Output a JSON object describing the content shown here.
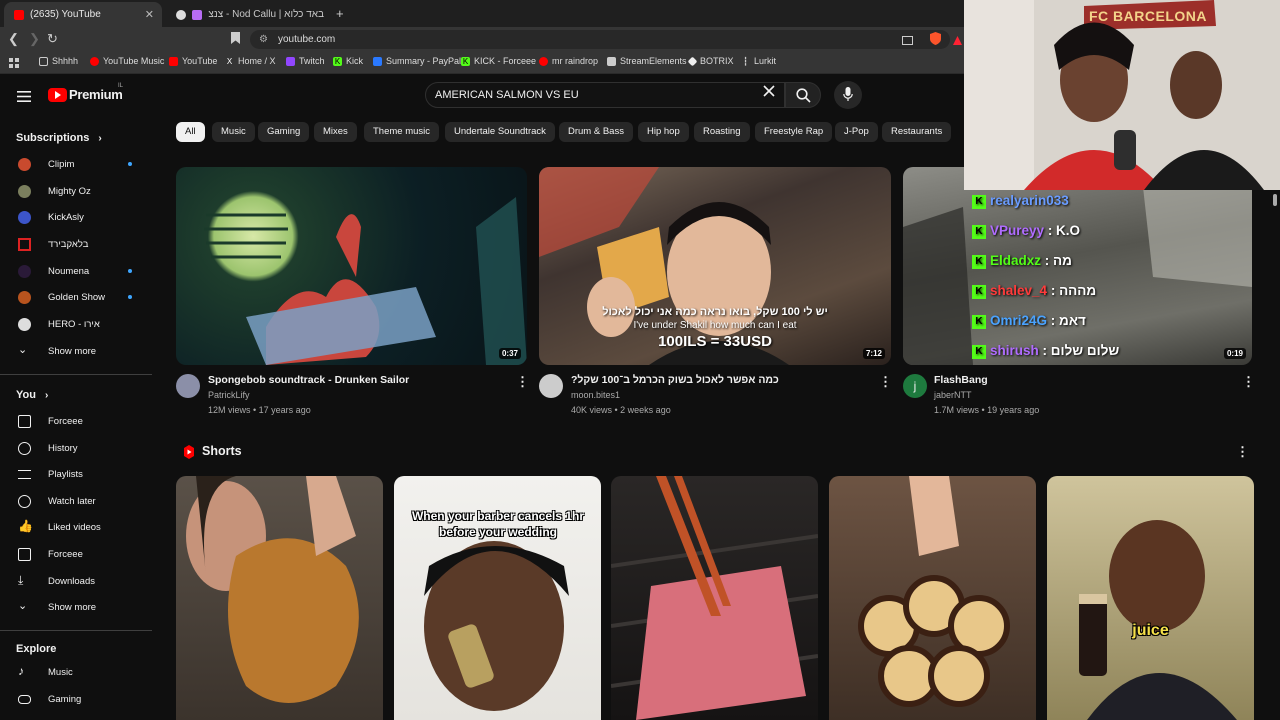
{
  "browser": {
    "tabs": [
      {
        "title": "(2635) YouTube",
        "active": true,
        "close": "✕"
      },
      {
        "title": "באד כלוא | Nod Callu - צנצנות גוּ",
        "active": false,
        "close": ""
      }
    ],
    "new_tab": "+",
    "url": "youtube.com",
    "bookmarks": [
      {
        "label": "Shhhh",
        "icon": "folder-icon"
      },
      {
        "label": "YouTube Music",
        "icon": "youtube-music-icon"
      },
      {
        "label": "YouTube",
        "icon": "youtube-icon"
      },
      {
        "label": "Home / X",
        "icon": "x-icon"
      },
      {
        "label": "Twitch",
        "icon": "twitch-icon"
      },
      {
        "label": "Kick",
        "icon": "kick-icon"
      },
      {
        "label": "Summary - PayPal",
        "icon": "paypal-icon"
      },
      {
        "label": "KICK - Forceee",
        "icon": "kick-icon"
      },
      {
        "label": "mr raindrop",
        "icon": "youtube-icon"
      },
      {
        "label": "StreamElements",
        "icon": "streamelements-icon"
      },
      {
        "label": "BOTRIX",
        "icon": "botrix-icon"
      },
      {
        "label": "Lurkit",
        "icon": "lurkit-icon"
      }
    ]
  },
  "header": {
    "logo_text": "Premium",
    "logo_sup": "IL",
    "search_value": "AMERICAN SALMON VS EU"
  },
  "chips": [
    "All",
    "Music",
    "Gaming",
    "Mixes",
    "Theme music",
    "Undertale Soundtrack",
    "Drum & Bass",
    "Hip hop",
    "Roasting",
    "Freestyle Rap",
    "J-Pop",
    "Restaurants"
  ],
  "sidebar": {
    "subscriptions_heading": "Subscriptions",
    "subscriptions": [
      {
        "label": "Clipim",
        "dot": true
      },
      {
        "label": "Mighty Oz",
        "dot": false
      },
      {
        "label": "KickAsly",
        "dot": false
      },
      {
        "label": "בלאקבירד",
        "dot": false
      },
      {
        "label": "Noumena",
        "dot": true
      },
      {
        "label": "Golden Show",
        "dot": true
      },
      {
        "label": "HERO - אירו",
        "dot": false
      }
    ],
    "show_more_1": "Show more",
    "you_heading": "You",
    "you_items": [
      {
        "label": "Forceee",
        "icon": "channel-icon"
      },
      {
        "label": "History",
        "icon": "history-icon"
      },
      {
        "label": "Playlists",
        "icon": "playlists-icon"
      },
      {
        "label": "Watch later",
        "icon": "watch-later-icon"
      },
      {
        "label": "Liked videos",
        "icon": "thumbs-up-icon"
      },
      {
        "label": "Forceee",
        "icon": "video-icon"
      },
      {
        "label": "Downloads",
        "icon": "download-icon"
      }
    ],
    "show_more_2": "Show more",
    "explore_heading": "Explore",
    "explore_items": [
      {
        "label": "Music",
        "icon": "music-icon"
      },
      {
        "label": "Gaming",
        "icon": "gaming-icon"
      }
    ]
  },
  "videos": [
    {
      "title": "Spongebob soundtrack - Drunken Sailor",
      "channel": "PatrickLify",
      "meta": "12M views • 17 years ago",
      "duration": "0:37"
    },
    {
      "title": "כמה אפשר לאכול בשוק הכרמל ב־100 שקל?",
      "channel": "moon.bites1",
      "meta": "40K views • 2 weeks ago",
      "duration": "7:12",
      "caption_he": "יש לי 100 שקל, בואו נראה כמה אני יכול לאכול",
      "caption_en": "I've under Shakil how much can I eat",
      "caption_big": "100ILS = 33USD"
    },
    {
      "title": "FlashBang",
      "channel": "jaberNTT",
      "meta": "1.7M views • 19 years ago",
      "duration": "0:19",
      "avatar_letter": "j"
    }
  ],
  "shorts": {
    "heading": "Shorts",
    "items": [
      {
        "caption": ""
      },
      {
        "caption": "When your barber cancels 1hr before your wedding"
      },
      {
        "caption": ""
      },
      {
        "caption": ""
      },
      {
        "caption": "juice"
      }
    ]
  },
  "overlay": {
    "banner": "FC BARCELONA",
    "chat": [
      {
        "user": "realyarin033",
        "msg": "",
        "color": "#6a9cff"
      },
      {
        "user": "VPureyy",
        "msg": ": K.O",
        "color": "#b06cff"
      },
      {
        "user": "Eldadxz",
        "msg": ": מה",
        "color": "#53fc18"
      },
      {
        "user": "shalev_4",
        "msg": ": מההה",
        "color": "#ff3b3b"
      },
      {
        "user": "Omri24G",
        "msg": ": דאמ",
        "color": "#4aa3ff"
      },
      {
        "user": "shirush",
        "msg": ": שלום שלום",
        "color": "#b06cff"
      }
    ]
  },
  "colors": {
    "bg": "#0f0f0f",
    "chip": "#272727",
    "accent": "#ff0000",
    "kick": "#53fc18"
  }
}
